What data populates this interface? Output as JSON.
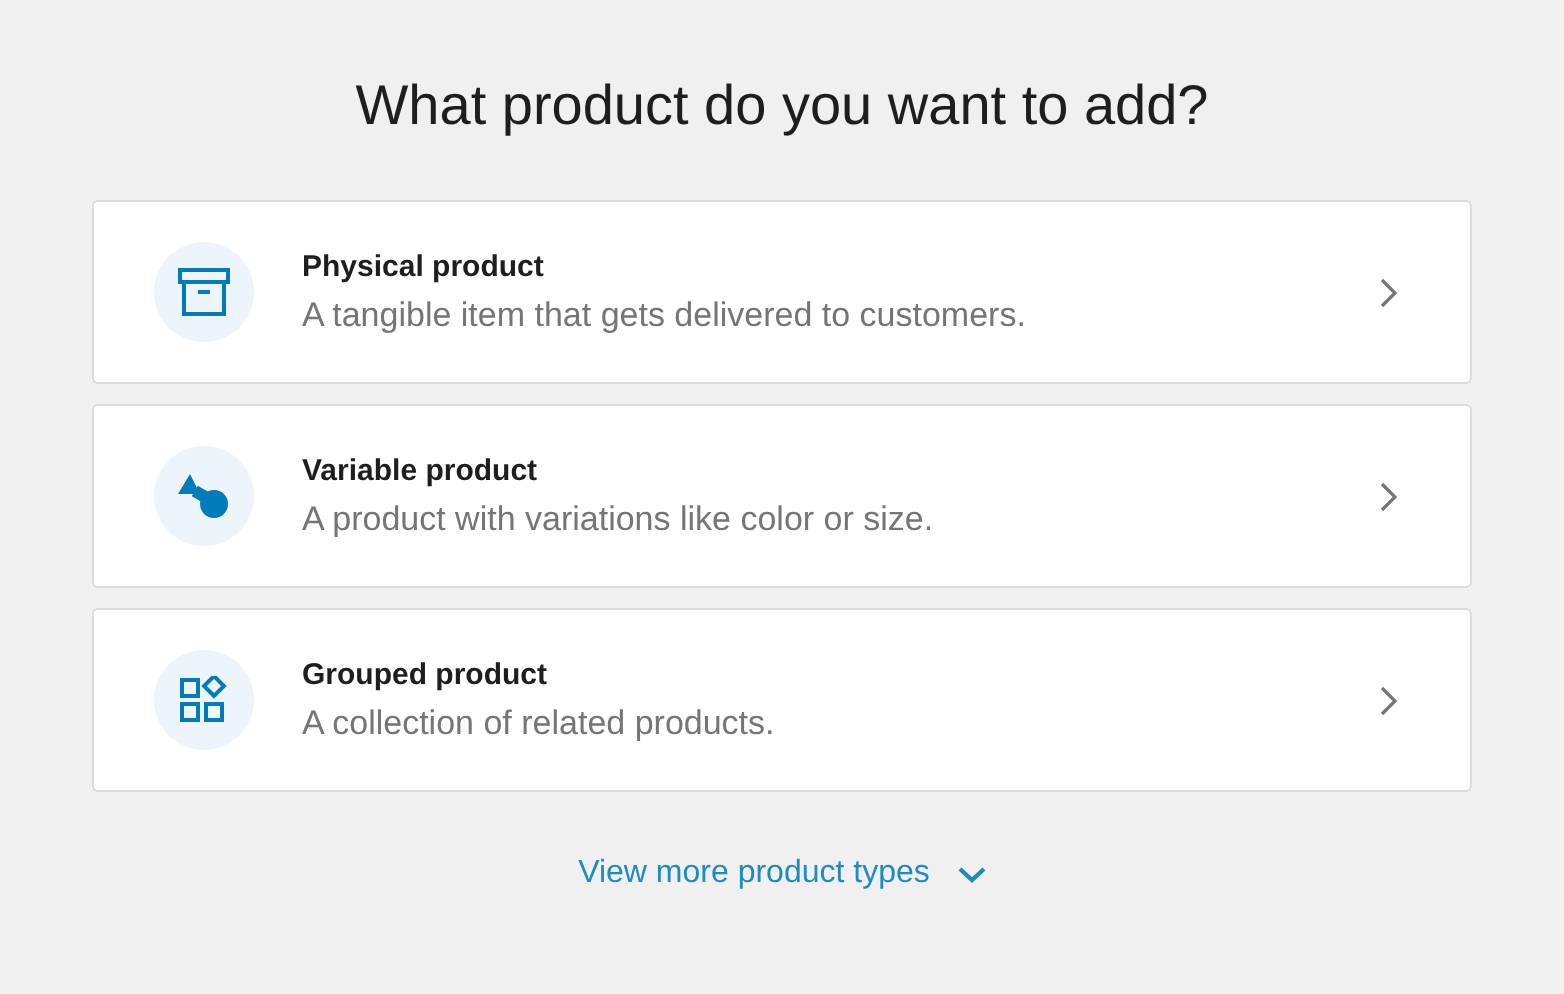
{
  "title": "What product do you want to add?",
  "options": [
    {
      "kind": "box",
      "name": "Physical product",
      "description": "A tangible item that gets delivered to customers."
    },
    {
      "kind": "shapes",
      "name": "Variable product",
      "description": "A product with variations like color or size."
    },
    {
      "kind": "grid",
      "name": "Grouped product",
      "description": "A collection of related products."
    }
  ],
  "more_link": "View more product types"
}
